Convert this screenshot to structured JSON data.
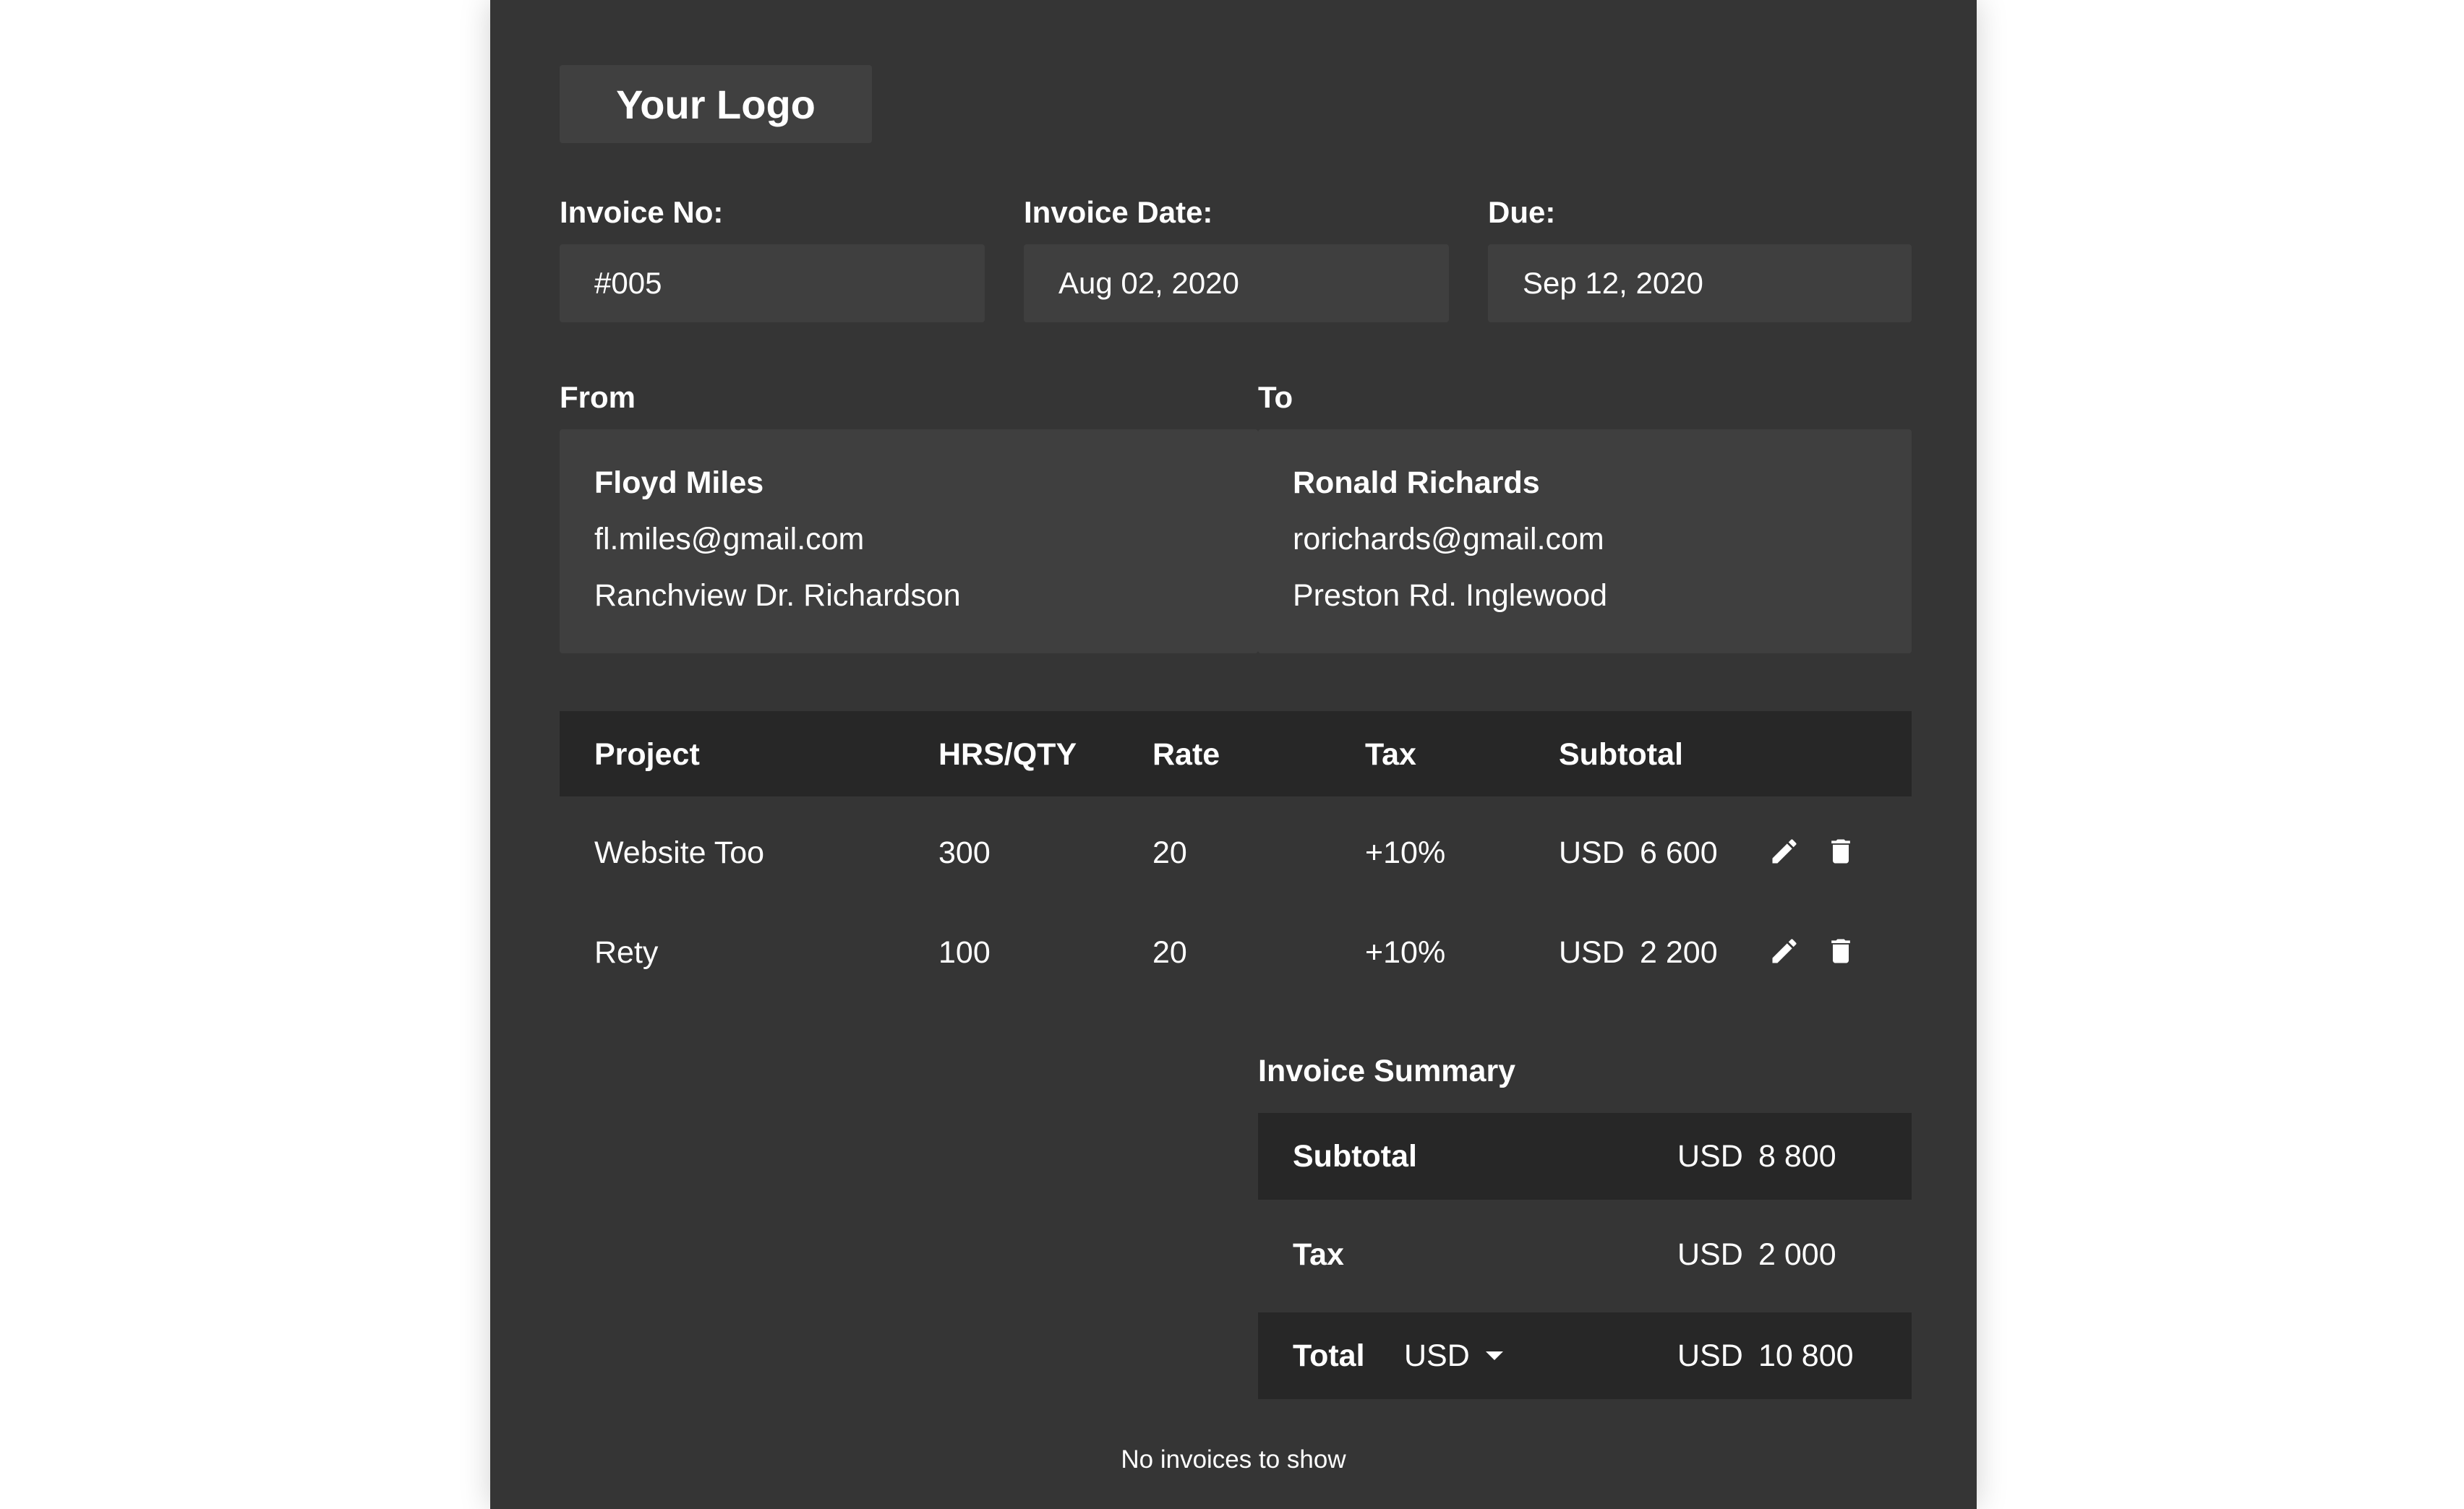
{
  "logo": {
    "text": "Your Logo"
  },
  "invoice": {
    "number_label": "Invoice No:",
    "number_value": "#005",
    "date_label": "Invoice Date:",
    "date_value": "Aug 02, 2020",
    "due_label": "Due:",
    "due_value": "Sep 12, 2020"
  },
  "from": {
    "label": "From",
    "name": "Floyd Miles",
    "email": "fl.miles@gmail.com",
    "address": "Ranchview Dr. Richardson"
  },
  "to": {
    "label": "To",
    "name": "Ronald Richards",
    "email": "rorichards@gmail.com",
    "address": "Preston Rd. Inglewood"
  },
  "table": {
    "headers": [
      "Project",
      "HRS/QTY",
      "Rate",
      "Tax",
      "Subtotal"
    ],
    "rows": [
      {
        "project": "Website Too",
        "qty": "300",
        "rate": "20",
        "tax": "+10%",
        "currency": "USD",
        "subtotal": "6 600"
      },
      {
        "project": "Rety",
        "qty": "100",
        "rate": "20",
        "tax": "+10%",
        "currency": "USD",
        "subtotal": "2 200"
      }
    ]
  },
  "icons": {
    "edit": "pencil-icon",
    "delete": "trash-icon",
    "dropdown": "caret-down-icon"
  },
  "summary": {
    "title": "Invoice Summary",
    "subtotal_label": "Subtotal",
    "subtotal_currency": "USD",
    "subtotal_value": "8 800",
    "tax_label": "Tax",
    "tax_currency": "USD",
    "tax_value": "2 000",
    "total_label": "Total",
    "total_currency_select": "USD",
    "total_currency": "USD",
    "total_value": "10 800"
  },
  "footer": {
    "note": "No invoices to show"
  },
  "colors": {
    "page_bg": "#353535",
    "field_bg": "#3f3f3f",
    "header_bg": "#272727",
    "text": "#ffffff"
  }
}
